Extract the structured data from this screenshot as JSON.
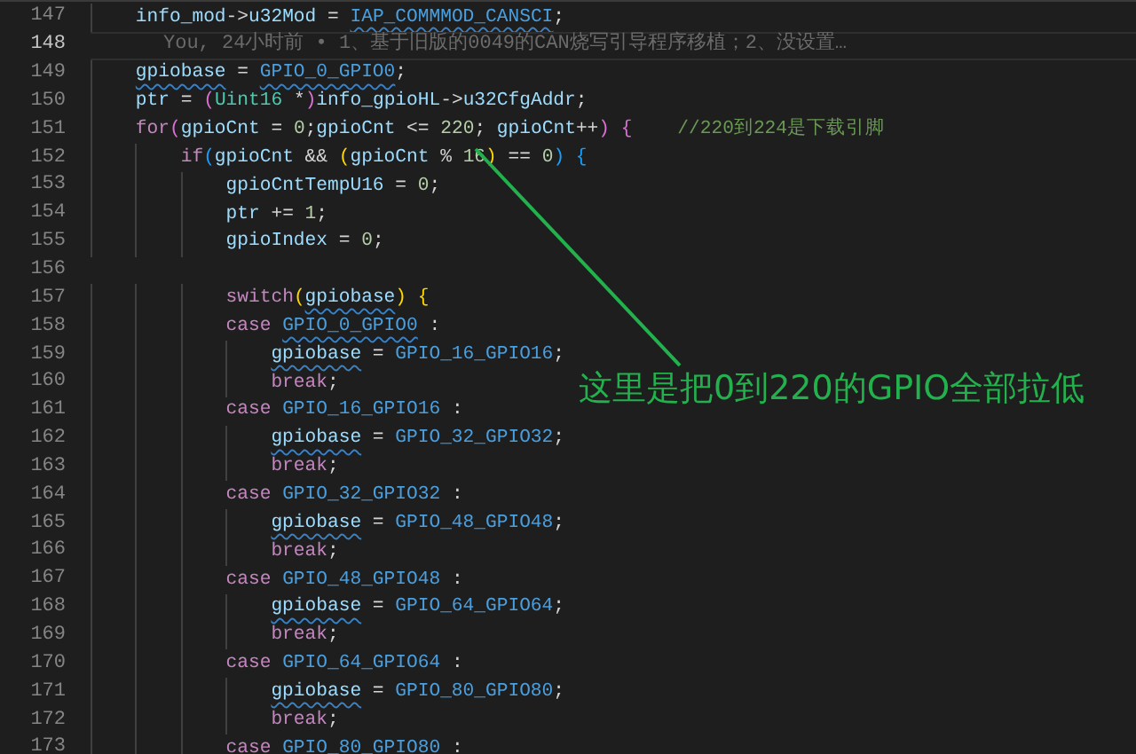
{
  "editor": {
    "lines": [
      {
        "number": "147",
        "current": false,
        "tokens": [
          {
            "kind": "var",
            "text": "    info_mod"
          },
          {
            "kind": "plain",
            "text": "->"
          },
          {
            "kind": "var",
            "text": "u32Mod"
          },
          {
            "kind": "plain",
            "text": " = "
          },
          {
            "kind": "const",
            "text": "IAP_COMMMOD_CANSCI",
            "squiggle": true
          },
          {
            "kind": "plain",
            "text": ";"
          }
        ]
      },
      {
        "number": "148",
        "current": true,
        "blame": "You, 24小时前 • 1、基于旧版的0049的CAN烧写引导程序移植；2、没设置…"
      },
      {
        "number": "149",
        "current": false,
        "tokens": [
          {
            "kind": "var",
            "text": "    gpiobase",
            "squiggle": true
          },
          {
            "kind": "plain",
            "text": " = "
          },
          {
            "kind": "const",
            "text": "GPIO_0_GPIO0",
            "squiggle": true
          },
          {
            "kind": "plain",
            "text": ";"
          }
        ]
      },
      {
        "number": "150",
        "current": false,
        "tokens": [
          {
            "kind": "var",
            "text": "    ptr"
          },
          {
            "kind": "plain",
            "text": " = "
          },
          {
            "kind": "b2",
            "text": "("
          },
          {
            "kind": "type",
            "text": "Uint16"
          },
          {
            "kind": "plain",
            "text": " *"
          },
          {
            "kind": "b2",
            "text": ")"
          },
          {
            "kind": "var",
            "text": "info_gpioHL"
          },
          {
            "kind": "plain",
            "text": "->"
          },
          {
            "kind": "var",
            "text": "u32CfgAddr"
          },
          {
            "kind": "plain",
            "text": ";"
          }
        ]
      },
      {
        "number": "151",
        "current": false,
        "tokens": [
          {
            "kind": "kw",
            "text": "    for"
          },
          {
            "kind": "b2",
            "text": "("
          },
          {
            "kind": "var",
            "text": "gpioCnt"
          },
          {
            "kind": "plain",
            "text": " = "
          },
          {
            "kind": "num",
            "text": "0"
          },
          {
            "kind": "plain",
            "text": ";"
          },
          {
            "kind": "var",
            "text": "gpioCnt"
          },
          {
            "kind": "plain",
            "text": " <= "
          },
          {
            "kind": "num",
            "text": "220"
          },
          {
            "kind": "plain",
            "text": "; "
          },
          {
            "kind": "var",
            "text": "gpioCnt"
          },
          {
            "kind": "plain",
            "text": "++"
          },
          {
            "kind": "b2",
            "text": ")"
          },
          {
            "kind": "b2",
            "text": " {"
          },
          {
            "kind": "comment",
            "text": "    //220到224是下载引脚"
          }
        ]
      },
      {
        "number": "152",
        "current": false,
        "tokens": [
          {
            "kind": "kw",
            "text": "        if"
          },
          {
            "kind": "b3",
            "text": "("
          },
          {
            "kind": "var",
            "text": "gpioCnt"
          },
          {
            "kind": "plain",
            "text": " && "
          },
          {
            "kind": "b1",
            "text": "("
          },
          {
            "kind": "var",
            "text": "gpioCnt"
          },
          {
            "kind": "plain",
            "text": " % "
          },
          {
            "kind": "num",
            "text": "16"
          },
          {
            "kind": "b1",
            "text": ")"
          },
          {
            "kind": "plain",
            "text": " == "
          },
          {
            "kind": "num",
            "text": "0"
          },
          {
            "kind": "b3",
            "text": ")"
          },
          {
            "kind": "b3",
            "text": " {"
          }
        ]
      },
      {
        "number": "153",
        "current": false,
        "tokens": [
          {
            "kind": "var",
            "text": "            gpioCntTempU16"
          },
          {
            "kind": "plain",
            "text": " = "
          },
          {
            "kind": "num",
            "text": "0"
          },
          {
            "kind": "plain",
            "text": ";"
          }
        ]
      },
      {
        "number": "154",
        "current": false,
        "tokens": [
          {
            "kind": "var",
            "text": "            ptr"
          },
          {
            "kind": "plain",
            "text": " += "
          },
          {
            "kind": "num",
            "text": "1"
          },
          {
            "kind": "plain",
            "text": ";"
          }
        ]
      },
      {
        "number": "155",
        "current": false,
        "tokens": [
          {
            "kind": "var",
            "text": "            gpioIndex"
          },
          {
            "kind": "plain",
            "text": " = "
          },
          {
            "kind": "num",
            "text": "0"
          },
          {
            "kind": "plain",
            "text": ";"
          }
        ]
      },
      {
        "number": "156",
        "current": false
      },
      {
        "number": "157",
        "current": false,
        "tokens": [
          {
            "kind": "kw",
            "text": "            switch"
          },
          {
            "kind": "b1",
            "text": "("
          },
          {
            "kind": "var",
            "text": "gpiobase",
            "squiggle": true
          },
          {
            "kind": "b1",
            "text": ")"
          },
          {
            "kind": "b1",
            "text": " {"
          }
        ]
      },
      {
        "number": "158",
        "current": false,
        "tokens": [
          {
            "kind": "kw",
            "text": "            case "
          },
          {
            "kind": "const",
            "text": "GPIO_0_GPIO0",
            "squiggle": true
          },
          {
            "kind": "plain",
            "text": " :"
          }
        ]
      },
      {
        "number": "159",
        "current": false,
        "tokens": [
          {
            "kind": "var",
            "text": "                gpiobase",
            "squiggle": true
          },
          {
            "kind": "plain",
            "text": " = "
          },
          {
            "kind": "const",
            "text": "GPIO_16_GPIO16"
          },
          {
            "kind": "plain",
            "text": ";"
          }
        ]
      },
      {
        "number": "160",
        "current": false,
        "tokens": [
          {
            "kind": "kw",
            "text": "                break"
          },
          {
            "kind": "plain",
            "text": ";"
          }
        ]
      },
      {
        "number": "161",
        "current": false,
        "tokens": [
          {
            "kind": "kw",
            "text": "            case "
          },
          {
            "kind": "const",
            "text": "GPIO_16_GPIO16"
          },
          {
            "kind": "plain",
            "text": " :"
          }
        ]
      },
      {
        "number": "162",
        "current": false,
        "tokens": [
          {
            "kind": "var",
            "text": "                gpiobase",
            "squiggle": true
          },
          {
            "kind": "plain",
            "text": " = "
          },
          {
            "kind": "const",
            "text": "GPIO_32_GPIO32"
          },
          {
            "kind": "plain",
            "text": ";"
          }
        ]
      },
      {
        "number": "163",
        "current": false,
        "tokens": [
          {
            "kind": "kw",
            "text": "                break"
          },
          {
            "kind": "plain",
            "text": ";"
          }
        ]
      },
      {
        "number": "164",
        "current": false,
        "tokens": [
          {
            "kind": "kw",
            "text": "            case "
          },
          {
            "kind": "const",
            "text": "GPIO_32_GPIO32"
          },
          {
            "kind": "plain",
            "text": " :"
          }
        ]
      },
      {
        "number": "165",
        "current": false,
        "tokens": [
          {
            "kind": "var",
            "text": "                gpiobase",
            "squiggle": true
          },
          {
            "kind": "plain",
            "text": " = "
          },
          {
            "kind": "const",
            "text": "GPIO_48_GPIO48"
          },
          {
            "kind": "plain",
            "text": ";"
          }
        ]
      },
      {
        "number": "166",
        "current": false,
        "tokens": [
          {
            "kind": "kw",
            "text": "                break"
          },
          {
            "kind": "plain",
            "text": ";"
          }
        ]
      },
      {
        "number": "167",
        "current": false,
        "tokens": [
          {
            "kind": "kw",
            "text": "            case "
          },
          {
            "kind": "const",
            "text": "GPIO_48_GPIO48"
          },
          {
            "kind": "plain",
            "text": " :"
          }
        ]
      },
      {
        "number": "168",
        "current": false,
        "tokens": [
          {
            "kind": "var",
            "text": "                gpiobase",
            "squiggle": true
          },
          {
            "kind": "plain",
            "text": " = "
          },
          {
            "kind": "const",
            "text": "GPIO_64_GPIO64"
          },
          {
            "kind": "plain",
            "text": ";"
          }
        ]
      },
      {
        "number": "169",
        "current": false,
        "tokens": [
          {
            "kind": "kw",
            "text": "                break"
          },
          {
            "kind": "plain",
            "text": ";"
          }
        ]
      },
      {
        "number": "170",
        "current": false,
        "tokens": [
          {
            "kind": "kw",
            "text": "            case "
          },
          {
            "kind": "const",
            "text": "GPIO_64_GPIO64"
          },
          {
            "kind": "plain",
            "text": " :"
          }
        ]
      },
      {
        "number": "171",
        "current": false,
        "tokens": [
          {
            "kind": "var",
            "text": "                gpiobase",
            "squiggle": true
          },
          {
            "kind": "plain",
            "text": " = "
          },
          {
            "kind": "const",
            "text": "GPIO_80_GPIO80"
          },
          {
            "kind": "plain",
            "text": ";"
          }
        ]
      },
      {
        "number": "172",
        "current": false,
        "tokens": [
          {
            "kind": "kw",
            "text": "                break"
          },
          {
            "kind": "plain",
            "text": ";"
          }
        ]
      },
      {
        "number": "173",
        "current": false,
        "tokens": [
          {
            "kind": "kw",
            "text": "            case "
          },
          {
            "kind": "const",
            "text": "GPIO_80_GPIO80"
          },
          {
            "kind": "plain",
            "text": " :"
          }
        ]
      }
    ]
  },
  "annotation": {
    "text": "这里是把0到220的GPIO全部拉低"
  }
}
